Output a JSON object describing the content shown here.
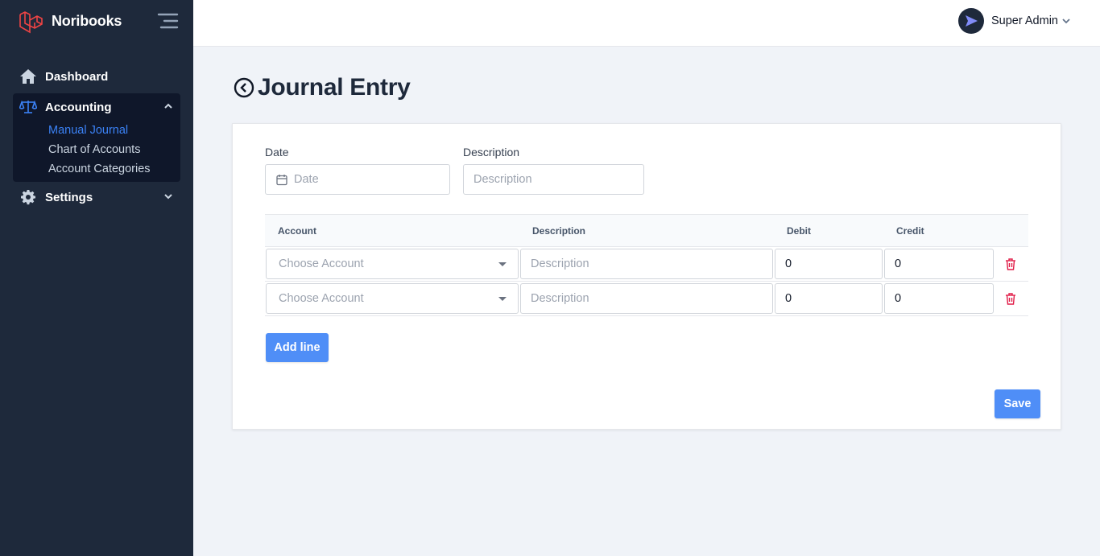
{
  "app": {
    "name": "Noribooks"
  },
  "colors": {
    "sidebar": "#1e293b",
    "accent": "#3b82f6",
    "button": "#4f8ef7",
    "danger": "#e11d48"
  },
  "sidebar": {
    "items": [
      {
        "label": "Dashboard",
        "icon": "home-icon"
      },
      {
        "label": "Accounting",
        "icon": "scale-icon",
        "expanded": true,
        "children": [
          {
            "label": "Manual Journal",
            "active": true
          },
          {
            "label": "Chart of Accounts"
          },
          {
            "label": "Account Categories"
          }
        ]
      },
      {
        "label": "Settings",
        "icon": "gear-icon",
        "expanded": false
      }
    ]
  },
  "header": {
    "user_name": "Super Admin"
  },
  "page": {
    "title": "Journal Entry"
  },
  "form": {
    "date_label": "Date",
    "date_placeholder": "Date",
    "description_label": "Description",
    "description_placeholder": "Description"
  },
  "table": {
    "headers": [
      "Account",
      "Description",
      "Debit",
      "Credit"
    ],
    "rows": [
      {
        "account_placeholder": "Choose Account",
        "description_placeholder": "Description",
        "debit": "0",
        "credit": "0"
      },
      {
        "account_placeholder": "Choose Account",
        "description_placeholder": "Description",
        "debit": "0",
        "credit": "0"
      }
    ]
  },
  "actions": {
    "add_line": "Add line",
    "save": "Save"
  }
}
